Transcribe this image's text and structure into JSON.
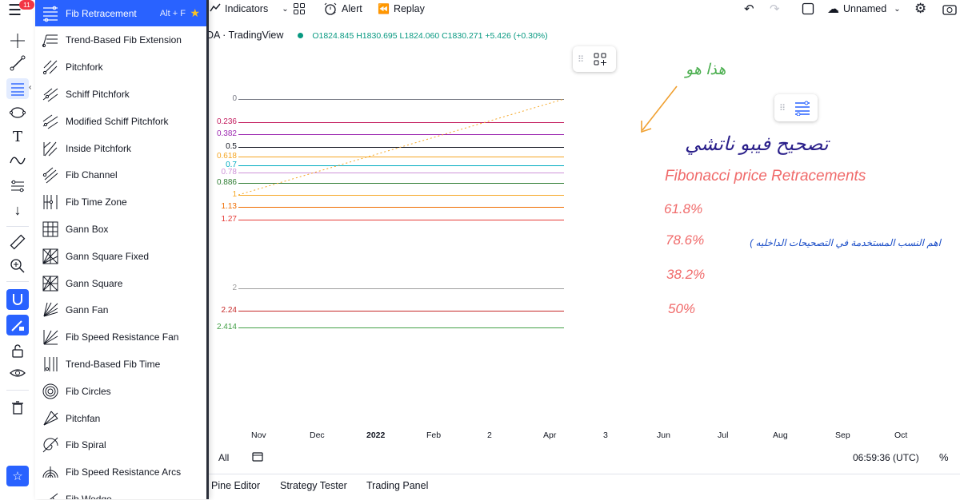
{
  "header": {
    "notification_count": "11",
    "indicators_label": "Indicators",
    "alert_label": "Alert",
    "replay_label": "Replay",
    "layout_name": "Unnamed"
  },
  "legend": {
    "symbol": "DA · TradingView",
    "open": "O1824.845",
    "high": "H1830.695",
    "low": "L1824.060",
    "close": "C1830.271",
    "change": "+5.426 (+0.30%)"
  },
  "menu": {
    "items": [
      {
        "label": "Fib Retracement",
        "hotkey": "Alt + F",
        "icon": "fib-retracement-icon"
      },
      {
        "label": "Trend-Based Fib Extension",
        "icon": "trend-fib-extension-icon"
      },
      {
        "label": "Pitchfork",
        "icon": "pitchfork-icon"
      },
      {
        "label": "Schiff Pitchfork",
        "icon": "schiff-pitchfork-icon"
      },
      {
        "label": "Modified Schiff Pitchfork",
        "icon": "modified-schiff-pitchfork-icon"
      },
      {
        "label": "Inside Pitchfork",
        "icon": "inside-pitchfork-icon"
      },
      {
        "label": "Fib Channel",
        "icon": "fib-channel-icon"
      },
      {
        "label": "Fib Time Zone",
        "icon": "fib-time-zone-icon"
      },
      {
        "label": "Gann Box",
        "icon": "gann-box-icon"
      },
      {
        "label": "Gann Square Fixed",
        "icon": "gann-square-fixed-icon"
      },
      {
        "label": "Gann Square",
        "icon": "gann-square-icon"
      },
      {
        "label": "Gann Fan",
        "icon": "gann-fan-icon"
      },
      {
        "label": "Fib Speed Resistance Fan",
        "icon": "fib-speed-fan-icon"
      },
      {
        "label": "Trend-Based Fib Time",
        "icon": "trend-fib-time-icon"
      },
      {
        "label": "Fib Circles",
        "icon": "fib-circles-icon"
      },
      {
        "label": "Pitchfan",
        "icon": "pitchfan-icon"
      },
      {
        "label": "Fib Spiral",
        "icon": "fib-spiral-icon"
      },
      {
        "label": "Fib Speed Resistance Arcs",
        "icon": "fib-speed-arcs-icon"
      },
      {
        "label": "Fib Wedge",
        "icon": "fib-wedge-icon"
      }
    ]
  },
  "fib_levels": [
    {
      "label": "0",
      "color": "#787b86"
    },
    {
      "label": "0.236",
      "color": "#c2185b"
    },
    {
      "label": "0.382",
      "color": "#9c27b0"
    },
    {
      "label": "0.5",
      "color": "#131722"
    },
    {
      "label": "0.618",
      "color": "#f5a623"
    },
    {
      "label": "0.7",
      "color": "#00acc1"
    },
    {
      "label": "0.78",
      "color": "#ce93d8"
    },
    {
      "label": "0.886",
      "color": "#2e7d32"
    },
    {
      "label": "1",
      "color": "#f5a623"
    },
    {
      "label": "1.13",
      "color": "#ef6c00"
    },
    {
      "label": "1.27",
      "color": "#e53935"
    },
    {
      "label": "2",
      "color": "#9e9e9e"
    },
    {
      "label": "2.24",
      "color": "#c62828"
    },
    {
      "label": "2.414",
      "color": "#43a047"
    }
  ],
  "x_axis": [
    "Nov",
    "Dec",
    "2022",
    "Feb",
    "2",
    "Apr",
    "3",
    "Jun",
    "Jul",
    "Aug",
    "Sep",
    "Oct"
  ],
  "annotations": {
    "this_is": "هذا هو",
    "title_ar": "تصحيح فيبو ناتشي",
    "subtitle_en": "Fibonacci price Retracements",
    "p1": "61.8%",
    "p2": "78.6%",
    "p3": "38.2%",
    "p4": "50%",
    "note_ar": "اهم النسب المستخدمة في التصحيحات الداخليه )"
  },
  "footer": {
    "range_all": "All",
    "time": "06:59:36 (UTC)",
    "percent": "%",
    "tabs": [
      "Pine Editor",
      "Strategy Tester",
      "Trading Panel"
    ]
  },
  "colors": {
    "accent": "#2962ff",
    "annotation_red": "#f06a6a",
    "annotation_green": "#4caf50",
    "annotation_navy": "#2a1f8a",
    "arrow_orange": "#f0a030",
    "note_blue": "#1e50c8"
  }
}
